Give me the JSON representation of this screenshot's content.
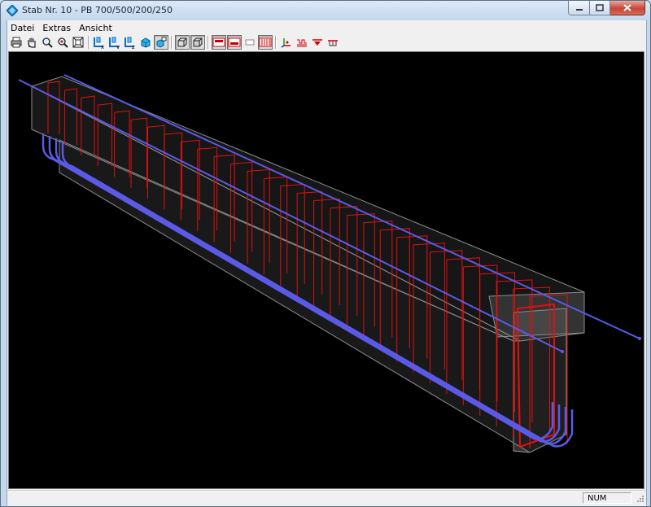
{
  "window": {
    "title": "Stab Nr. 10 - PB 700/500/200/250"
  },
  "menu": {
    "items": [
      {
        "label": "Datei"
      },
      {
        "label": "Extras"
      },
      {
        "label": "Ansicht"
      }
    ]
  },
  "toolbar": {
    "buttons": [
      {
        "icon": "print-icon"
      },
      {
        "icon": "pan-hand-icon"
      },
      {
        "icon": "zoom-icon"
      },
      {
        "icon": "zoom-window-icon"
      },
      {
        "icon": "zoom-extents-icon"
      },
      {
        "icon": "view-x-icon",
        "letter": "x"
      },
      {
        "icon": "view-y-icon",
        "letter": "y"
      },
      {
        "icon": "view-z-icon",
        "letter": "z"
      },
      {
        "icon": "iso-view-icon"
      },
      {
        "icon": "iso-view-active-icon",
        "pressed": true
      },
      {
        "icon": "wireframe-icon",
        "pressed": true
      },
      {
        "icon": "solid-icon",
        "pressed": true
      },
      {
        "icon": "section-top-icon",
        "pressed": true
      },
      {
        "icon": "section-bottom-icon",
        "pressed": true
      },
      {
        "icon": "section-plain-icon"
      },
      {
        "icon": "stirrups-icon",
        "pressed": true
      },
      {
        "icon": "axes-icon"
      },
      {
        "icon": "rebar-layer-icon"
      },
      {
        "icon": "support-icon"
      },
      {
        "icon": "section-icon"
      }
    ]
  },
  "status": {
    "num": "NUM"
  },
  "colors": {
    "stirrup": "#e01010",
    "longitudinal_bar": "#5a5ae6",
    "concrete_edge": "#8c8c8c"
  }
}
